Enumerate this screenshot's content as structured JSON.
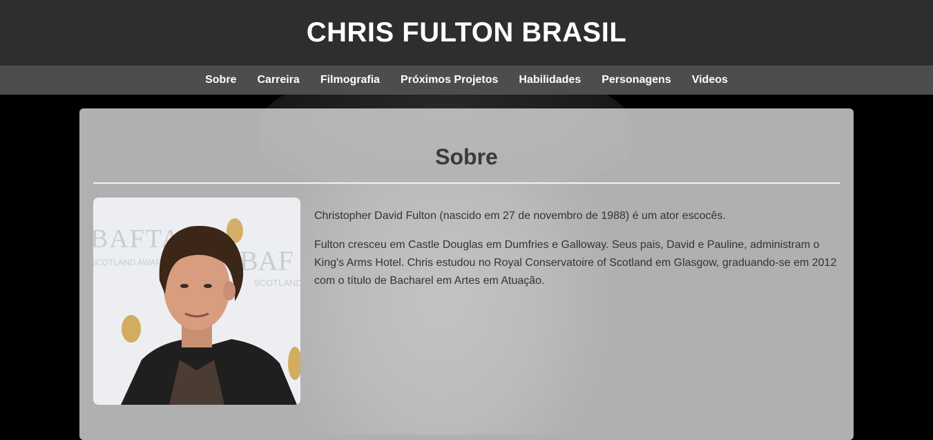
{
  "header": {
    "title": "CHRIS FULTON BRASIL"
  },
  "nav": {
    "items": [
      {
        "label": "Sobre"
      },
      {
        "label": "Carreira"
      },
      {
        "label": "Filmografia"
      },
      {
        "label": "Próximos Projetos"
      },
      {
        "label": "Habilidades"
      },
      {
        "label": "Personagens"
      },
      {
        "label": "Videos"
      }
    ]
  },
  "section": {
    "heading": "Sobre",
    "paragraphs": [
      "Christopher David Fulton (nascido em 27 de novembro de 1988) é um ator escocês.",
      "Fulton cresceu em Castle Douglas em Dumfries e Galloway. Seus pais, David e Pauline, administram o King's Arms Hotel. Chris estudou no Royal Conservatoire of Scotland em Glasgow, graduando-se em 2012 com o título de Bacharel em Artes em Atuação."
    ],
    "photo_backdrop_text": [
      "BAFTA",
      "SCOTLAND AWARDS",
      "BAF",
      "SCOTLAND"
    ]
  },
  "colors": {
    "header_bg": "#2e2e2e",
    "nav_bg": "#4d4d4d",
    "heading_text": "#3a3a3a",
    "body_text": "#333333",
    "bafta_gold": "#c9962e"
  }
}
